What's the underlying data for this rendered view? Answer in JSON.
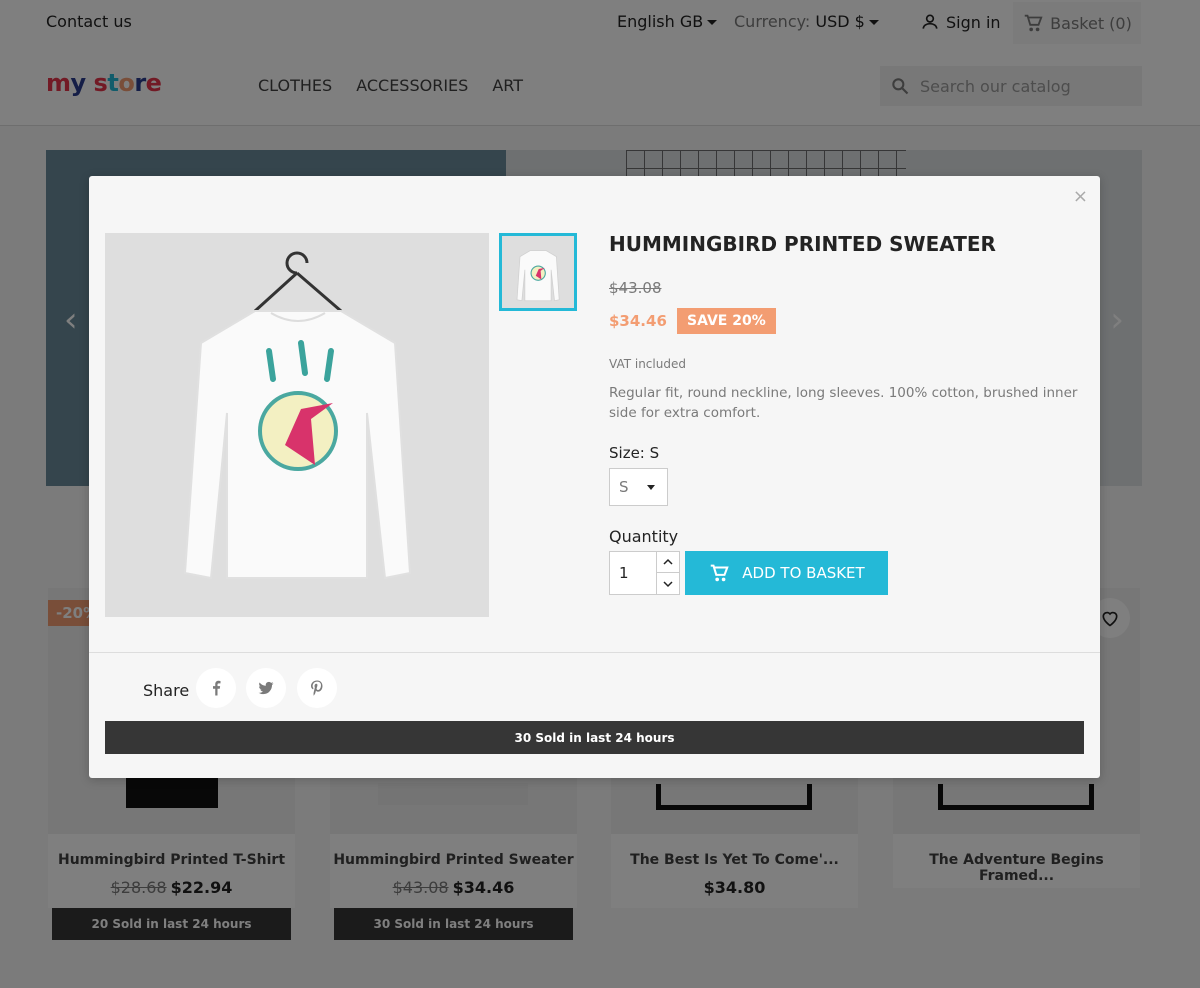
{
  "topbar": {
    "contact": "Contact us",
    "language": "English GB",
    "currency_label": "Currency:",
    "currency_value": "USD $",
    "sign_in": "Sign in",
    "basket": "Basket (0)"
  },
  "header": {
    "logo": "my store",
    "nav": [
      "CLOTHES",
      "ACCESSORIES",
      "ART"
    ],
    "search_placeholder": "Search our catalog"
  },
  "products": [
    {
      "name": "Hummingbird Printed T-Shirt",
      "old_price": "$28.68",
      "price": "$22.94",
      "sold": "20 Sold in last 24 hours",
      "discount": "-20%"
    },
    {
      "name": "Hummingbird Printed Sweater",
      "old_price": "$43.08",
      "price": "$34.46",
      "sold": "30 Sold in last 24 hours"
    },
    {
      "name": "The Best Is Yet To Come'...",
      "price": "$34.80"
    },
    {
      "name": "The Adventure Begins Framed..."
    }
  ],
  "modal": {
    "close": "×",
    "title": "HUMMINGBIRD PRINTED SWEATER",
    "old_price": "$43.08",
    "price": "$34.46",
    "save": "SAVE 20%",
    "vat": "VAT included",
    "description": "Regular fit, round neckline, long sleeves. 100% cotton, brushed inner side for extra comfort.",
    "size_label": "Size: S",
    "size_value": "S",
    "quantity_label": "Quantity",
    "quantity_value": "1",
    "add_to_basket": "ADD TO BASKET",
    "share_label": "Share",
    "sold": "30 Sold in last 24 hours"
  },
  "colors": {
    "accent": "#24b9d7",
    "discount": "#f39d72",
    "dark_bar": "#363636"
  }
}
